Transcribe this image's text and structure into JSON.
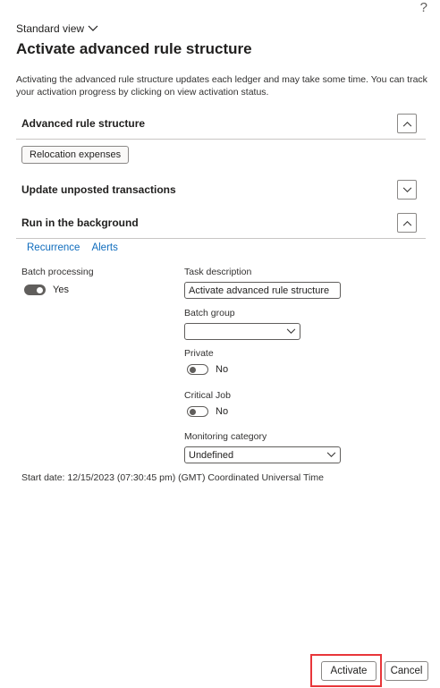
{
  "help_glyph": "?",
  "view_selector": {
    "label": "Standard view"
  },
  "dialog": {
    "title": "Activate advanced rule structure",
    "description": "Activating the advanced rule structure updates each ledger and may take some time. You can track your activation progress by clicking on view activation status."
  },
  "sections": {
    "advanced": {
      "label": "Advanced rule structure",
      "chip": "Relocation expenses"
    },
    "update": {
      "label": "Update unposted transactions"
    },
    "background": {
      "label": "Run in the background"
    }
  },
  "links": {
    "recurrence": "Recurrence",
    "alerts": "Alerts"
  },
  "batch": {
    "label": "Batch processing",
    "value": "Yes",
    "task_label": "Task description",
    "task_value": "Activate advanced rule structure",
    "group_label": "Batch group",
    "group_value": "",
    "private_label": "Private",
    "private_value": "No",
    "critical_label": "Critical Job",
    "critical_value": "No",
    "monitoring_label": "Monitoring category",
    "monitoring_value": "Undefined"
  },
  "start_date": "Start date: 12/15/2023 (07:30:45 pm) (GMT) Coordinated Universal Time",
  "buttons": {
    "activate": "Activate",
    "cancel": "Cancel"
  },
  "colors": {
    "link": "#0f6cbd",
    "highlight": "#e8363a",
    "toggle_on": "#605e5c"
  },
  "icons": {
    "expand_up": "chevron-up-icon",
    "expand_down": "chevron-down-icon",
    "help": "help-icon"
  }
}
